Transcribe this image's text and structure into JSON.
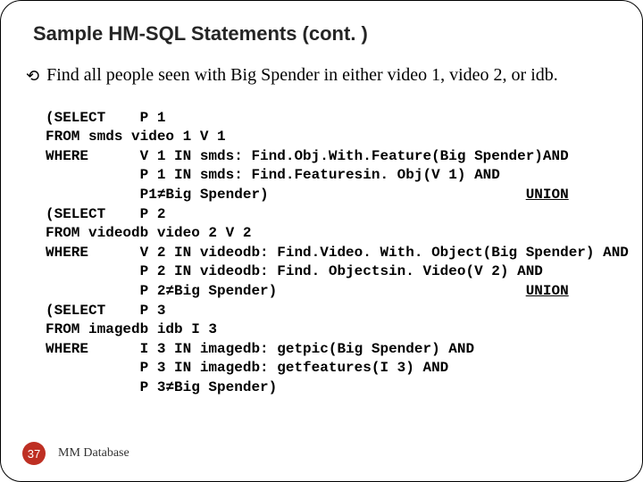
{
  "title": "Sample HM-SQL Statements (cont. )",
  "prompt": "Find all people seen with Big Spender in either video 1, video 2, or idb.",
  "code": {
    "l1": "(SELECT    P 1",
    "l2": "FROM smds video 1 V 1",
    "l3": "WHERE      V 1 IN smds: Find.Obj.With.Feature(Big Spender)AND",
    "l4": "           P 1 IN smds: Find.Featuresin. Obj(V 1) AND",
    "l5a": "           P1≠Big Spender)",
    "l5b": "UNION",
    "l6": "(SELECT    P 2",
    "l7": "FROM videodb video 2 V 2",
    "l8": "WHERE      V 2 IN videodb: Find.Video. With. Object(Big Spender) AND",
    "l9": "           P 2 IN videodb: Find. Objectsin. Video(V 2) AND",
    "l10a": "           P 2≠Big Spender)",
    "l10b": "UNION",
    "l11": "(SELECT    P 3",
    "l12": "FROM imagedb idb I 3",
    "l13": "WHERE      I 3 IN imagedb: getpic(Big Spender) AND",
    "l14": "           P 3 IN imagedb: getfeatures(I 3) AND",
    "l15": "           P 3≠Big Spender)"
  },
  "footer": {
    "page": "37",
    "label": "MM Database"
  }
}
